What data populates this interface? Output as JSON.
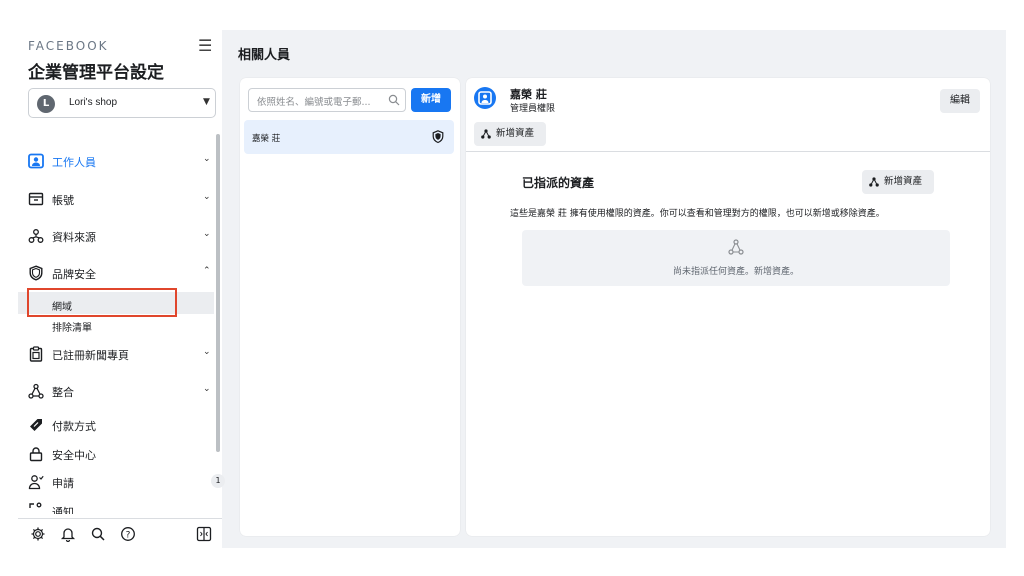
{
  "sidebar": {
    "brand": "FACEBOOK",
    "title": "企業管理平台設定",
    "account": {
      "initial": "L",
      "name": "Lori's shop"
    },
    "items": [
      {
        "label": "工作人員",
        "icon": "people-badge-icon",
        "active": true
      },
      {
        "label": "帳號",
        "icon": "inbox-icon"
      },
      {
        "label": "資料來源",
        "icon": "data-sources-icon"
      },
      {
        "label": "品牌安全",
        "icon": "shield-icon"
      },
      {
        "label": "已註冊新聞專頁",
        "icon": "clipboard-icon"
      },
      {
        "label": "整合",
        "icon": "integrations-icon"
      },
      {
        "label": "付款方式",
        "icon": "tag-icon"
      },
      {
        "label": "安全中心",
        "icon": "lock-icon"
      },
      {
        "label": "申請",
        "icon": "person-request-icon",
        "badge": "1"
      },
      {
        "label": "通知",
        "icon": "bell-icon"
      }
    ],
    "subitems": [
      "網域",
      "排除清單"
    ],
    "footer_icons": [
      "gear-icon",
      "bell-icon",
      "search-icon",
      "help-icon",
      "panel-toggle-icon"
    ]
  },
  "main": {
    "page_title": "相關人員",
    "list": {
      "search_placeholder": "依照姓名、編號或電子郵...",
      "add_button": "新增",
      "people": [
        {
          "name": "嘉榮 莊"
        }
      ]
    },
    "detail": {
      "name": "嘉榮 莊",
      "role": "管理員權限",
      "edit_button": "編輯",
      "add_asset_button": "新增資產",
      "section_title": "已指派的資產",
      "section_add_button": "新增資產",
      "description": "這些是嘉榮 莊 擁有使用權限的資產。你可以查看和管理對方的權限，也可以新增或移除資產。",
      "empty_text": "尚未指派任何資產。新增資產。"
    }
  },
  "colors": {
    "accent": "#1877f2",
    "highlight_border": "#e0462c"
  }
}
